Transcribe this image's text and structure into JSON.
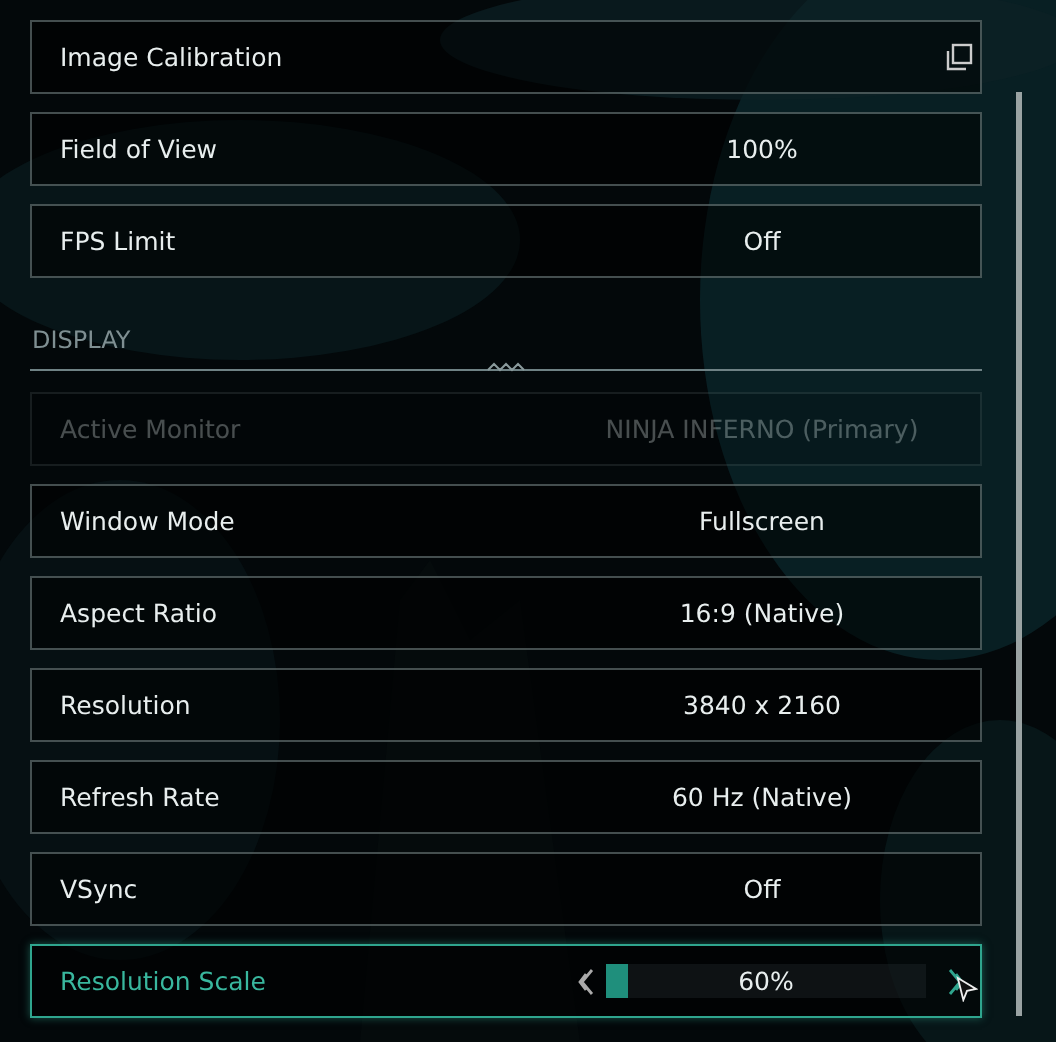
{
  "settings": [
    {
      "kind": "action",
      "label": "Image Calibration",
      "selected": false,
      "disabled": false
    },
    {
      "kind": "value",
      "label": "Field of View",
      "value": "100%",
      "selected": false,
      "disabled": false
    },
    {
      "kind": "value",
      "label": "FPS Limit",
      "value": "Off",
      "selected": false,
      "disabled": false
    }
  ],
  "section": {
    "title": "DISPLAY"
  },
  "display_settings": [
    {
      "kind": "value",
      "label": "Active Monitor",
      "value": "NINJA INFERNO (Primary)",
      "selected": false,
      "disabled": true
    },
    {
      "kind": "value",
      "label": "Window Mode",
      "value": "Fullscreen",
      "selected": false,
      "disabled": false
    },
    {
      "kind": "value",
      "label": "Aspect Ratio",
      "value": "16:9 (Native)",
      "selected": false,
      "disabled": false
    },
    {
      "kind": "value",
      "label": "Resolution",
      "value": "3840 x 2160",
      "selected": false,
      "disabled": false
    },
    {
      "kind": "value",
      "label": "Refresh Rate",
      "value": "60 Hz (Native)",
      "selected": false,
      "disabled": false
    },
    {
      "kind": "value",
      "label": "VSync",
      "value": "Off",
      "selected": false,
      "disabled": false
    },
    {
      "kind": "slider",
      "label": "Resolution Scale",
      "value": "60%",
      "level": 0.07,
      "selected": true,
      "disabled": false
    }
  ]
}
